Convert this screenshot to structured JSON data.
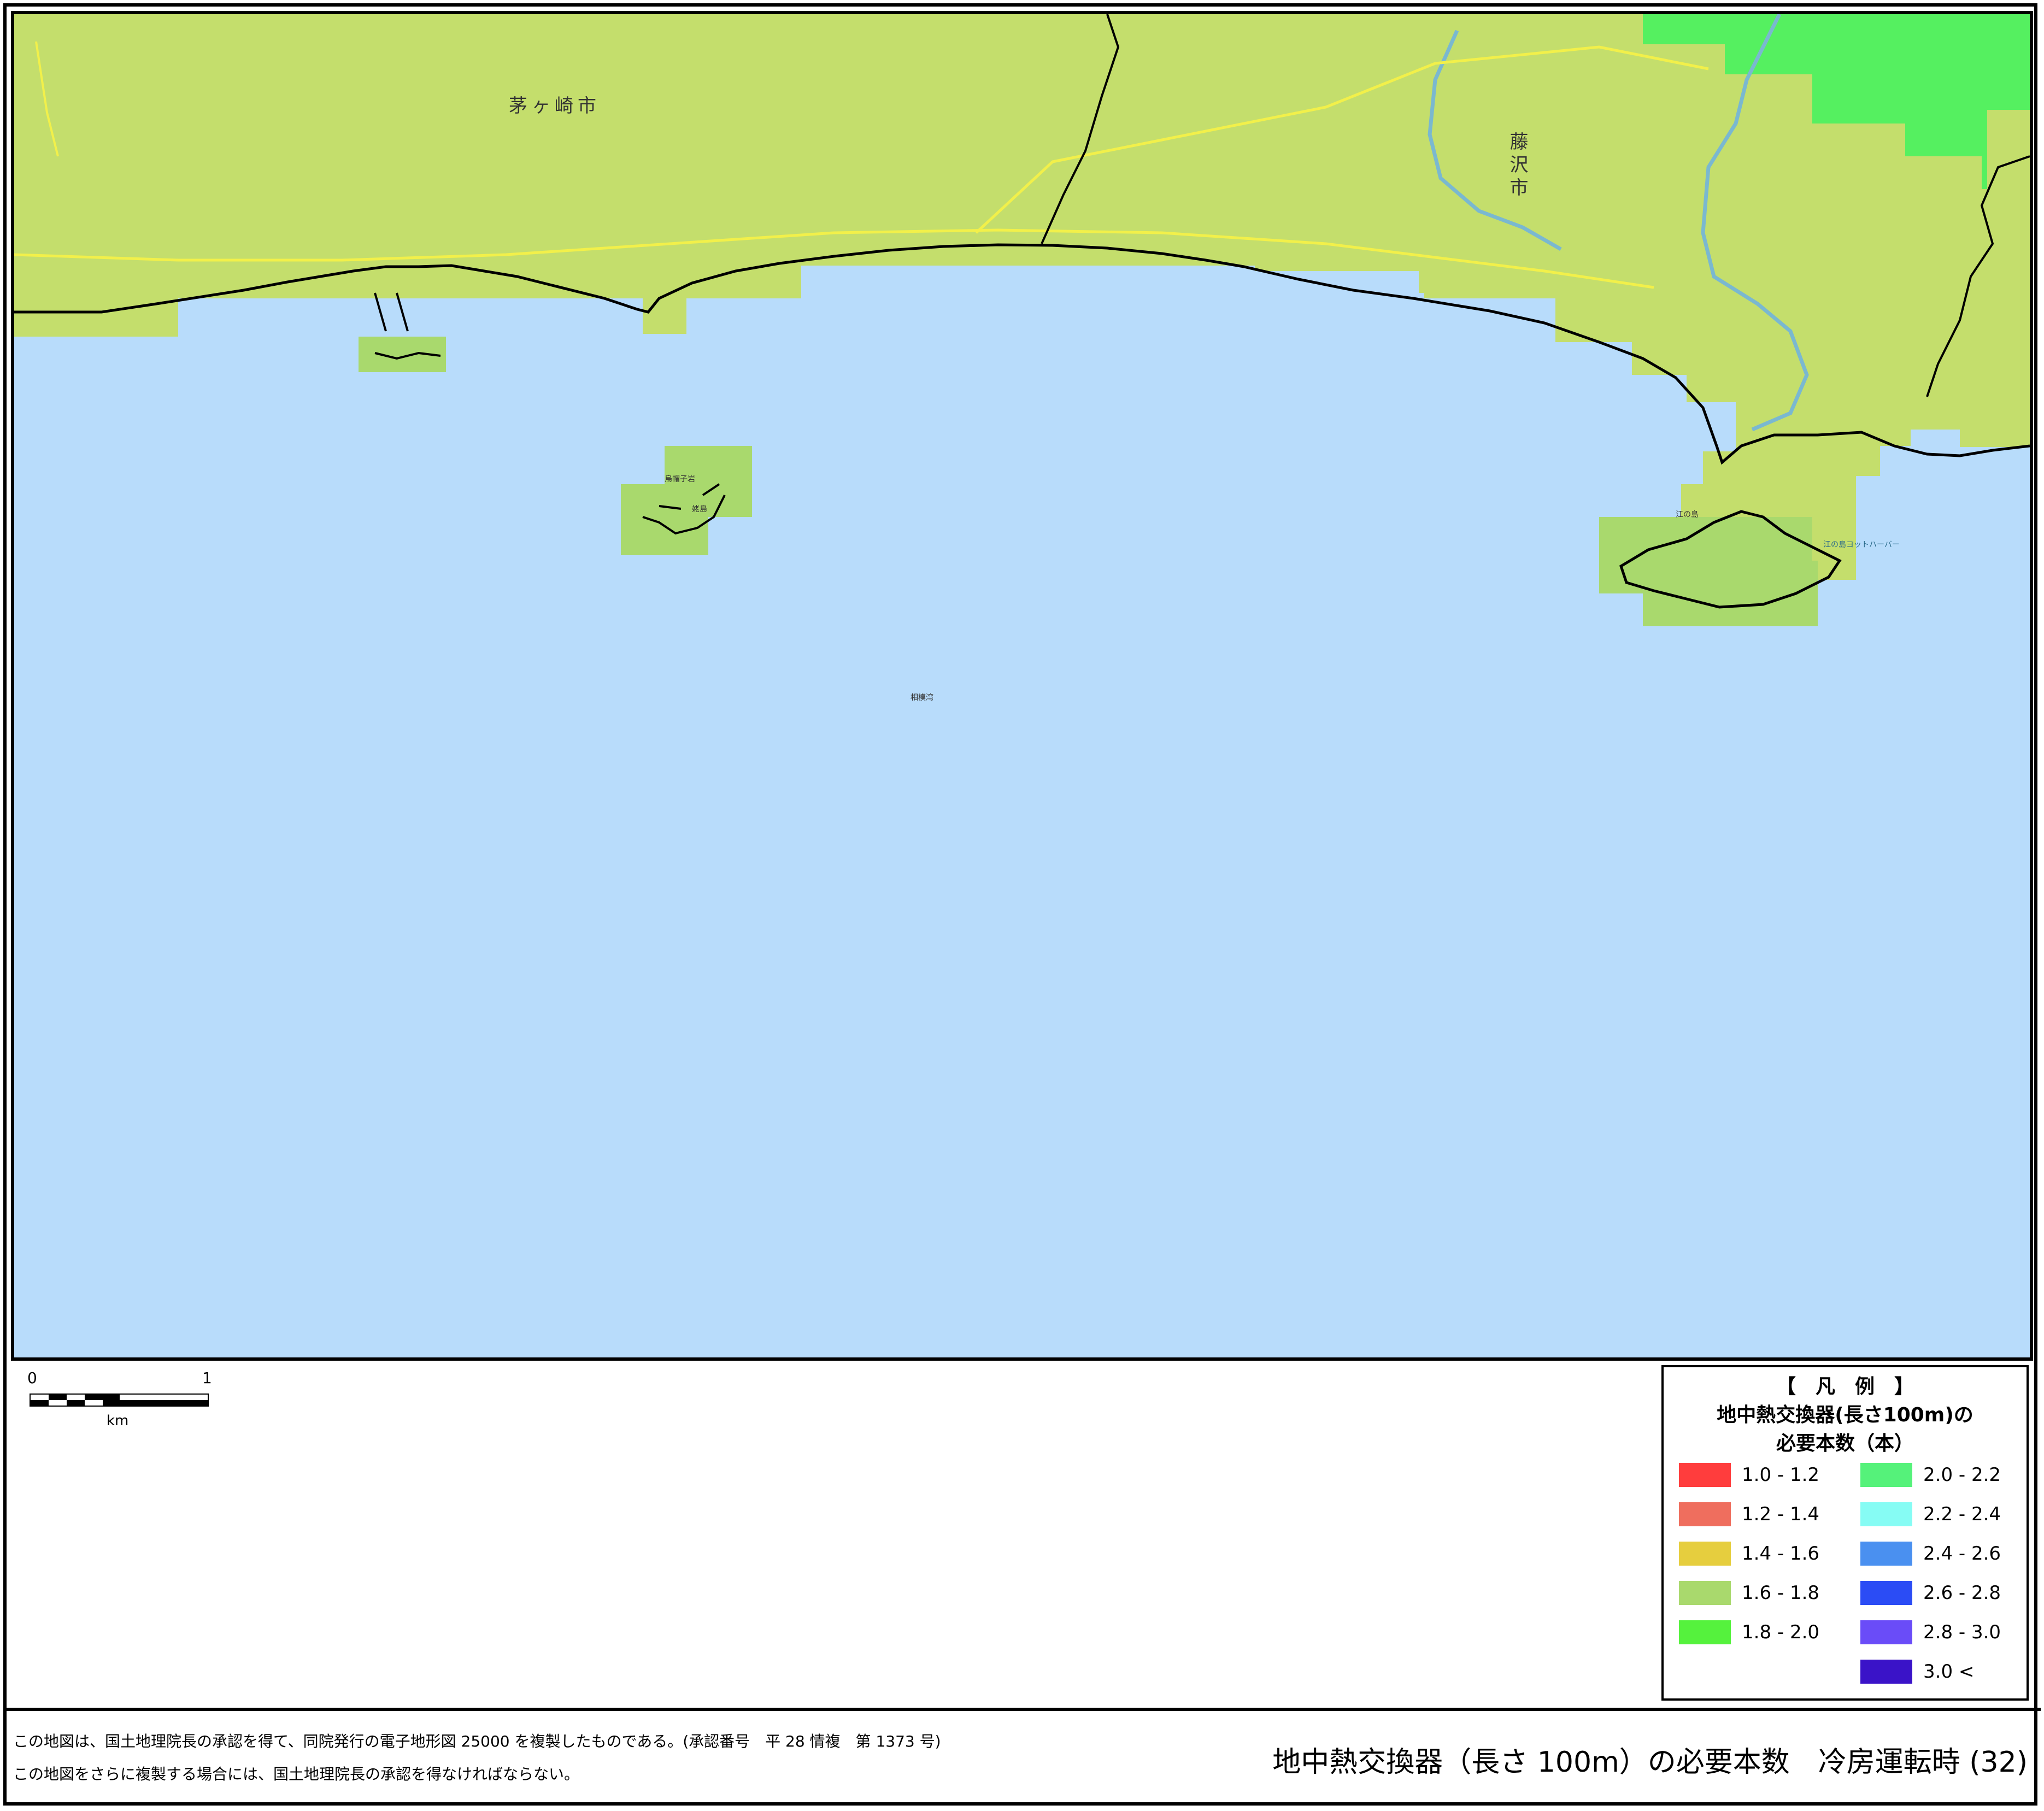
{
  "map": {
    "region_labels": [
      "茅ヶ崎市",
      "藤沢市",
      "相模湾"
    ],
    "place_labels": [
      "江の島",
      "江の島ヨットハーバー",
      "烏帽子岩",
      "姥島"
    ],
    "colors": {
      "sea": "#b8dcfb",
      "land_default": "#c4de6c",
      "land_cell": "#a9d96d",
      "land_green": "#55f060",
      "road": "#f2f04a",
      "river": "#7ab8d0",
      "coast": "#000000"
    }
  },
  "scale": {
    "start": "0",
    "end": "1",
    "unit": "km"
  },
  "legend": {
    "title": "【　凡　例　】",
    "subtitle_line1": "地中熱交換器(長さ100m)の",
    "subtitle_line2": "必要本数（本）",
    "items": [
      {
        "label": "1.0 - 1.2",
        "color": "#ff3d3d"
      },
      {
        "label": "1.2 - 1.4",
        "color": "#ef6e5e"
      },
      {
        "label": "1.4 - 1.6",
        "color": "#e6ce3e"
      },
      {
        "label": "1.6 - 1.8",
        "color": "#a9d96d"
      },
      {
        "label": "1.8 - 2.0",
        "color": "#55f23d"
      },
      {
        "label": "2.0 - 2.2",
        "color": "#55f27a"
      },
      {
        "label": "2.2 - 2.4",
        "color": "#86fcf4"
      },
      {
        "label": "2.4 - 2.6",
        "color": "#4a90f0"
      },
      {
        "label": "2.6 - 2.8",
        "color": "#2b4cf5"
      },
      {
        "label": "2.8 - 3.0",
        "color": "#6a4cf8"
      },
      {
        "label": "3.0 <",
        "color": "#3a13c8"
      }
    ]
  },
  "footer": {
    "note1": "この地図は、国土地理院長の承認を得て、同院発行の電子地形図 25000 を複製したものである。(承認番号　平 28 情複　第 1373 号)",
    "note2": "この地図をさらに複製する場合には、国土地理院長の承認を得なければならない。",
    "title": "地中熱交換器（長さ 100m）の必要本数　冷房運転時 (32)"
  }
}
